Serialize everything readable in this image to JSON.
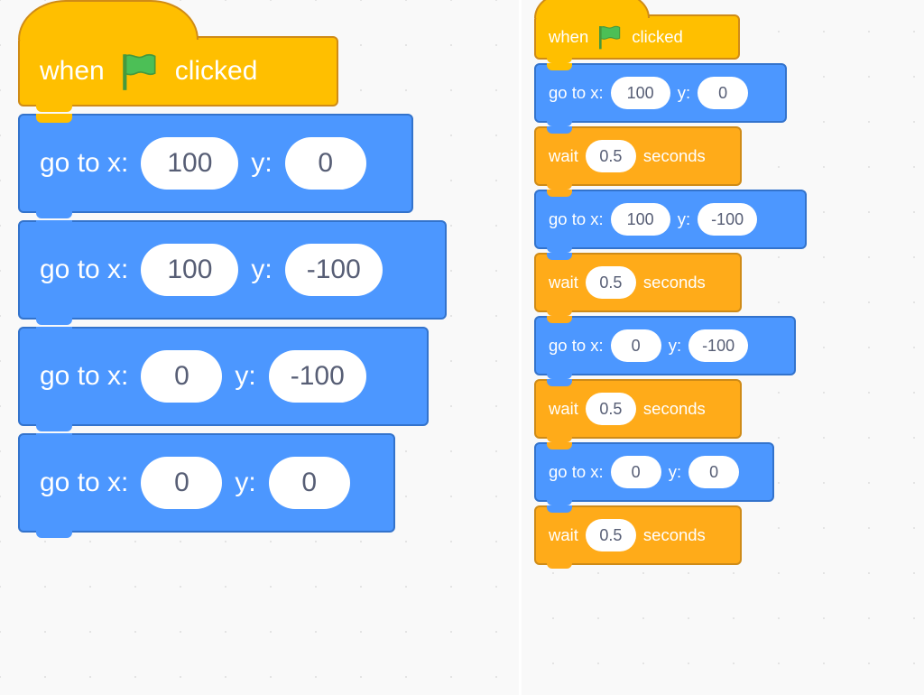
{
  "hat": {
    "when": "when",
    "clicked": "clicked"
  },
  "motion": {
    "gotox": "go to x:",
    "y": "y:"
  },
  "control": {
    "wait": "wait",
    "seconds": "seconds"
  },
  "left": {
    "blocks": [
      {
        "x": "100",
        "y": "0"
      },
      {
        "x": "100",
        "y": "-100"
      },
      {
        "x": "0",
        "y": "-100"
      },
      {
        "x": "0",
        "y": "0"
      }
    ]
  },
  "right": {
    "blocks": [
      {
        "type": "goto",
        "x": "100",
        "y": "0"
      },
      {
        "type": "wait",
        "secs": "0.5"
      },
      {
        "type": "goto",
        "x": "100",
        "y": "-100"
      },
      {
        "type": "wait",
        "secs": "0.5"
      },
      {
        "type": "goto",
        "x": "0",
        "y": "-100"
      },
      {
        "type": "wait",
        "secs": "0.5"
      },
      {
        "type": "goto",
        "x": "0",
        "y": "0"
      },
      {
        "type": "wait",
        "secs": "0.5"
      }
    ]
  },
  "colors": {
    "events": "#ffbf00",
    "motion": "#4c97ff",
    "control": "#ffab19",
    "flag": "#4cbf56"
  }
}
